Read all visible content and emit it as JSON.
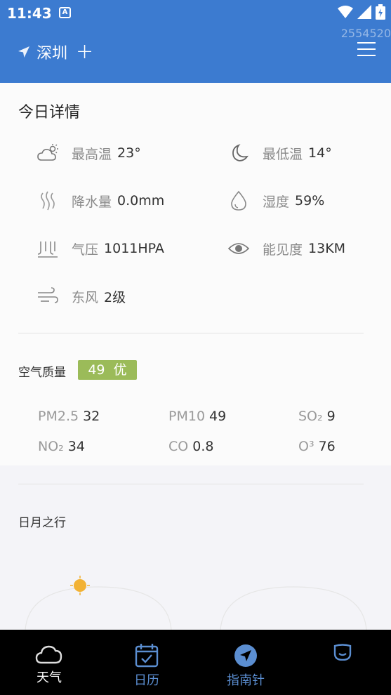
{
  "status": {
    "time": "11:43",
    "notif": "A"
  },
  "watermark": "2554520",
  "header": {
    "city": "深圳"
  },
  "today": {
    "title": "今日详情",
    "items": [
      {
        "label": "最高温",
        "value": "23°",
        "icon": "cloud-sun-icon"
      },
      {
        "label": "最低温",
        "value": "14°",
        "icon": "moon-icon"
      },
      {
        "label": "降水量",
        "value": "0.0mm",
        "icon": "rain-icon"
      },
      {
        "label": "湿度",
        "value": "59%",
        "icon": "humidity-drop-icon"
      },
      {
        "label": "气压",
        "value": "1011HPA",
        "icon": "pressure-icon"
      },
      {
        "label": "能见度",
        "value": "13KM",
        "icon": "eye-icon"
      },
      {
        "label": "东风",
        "value": "2级",
        "icon": "wind-icon"
      }
    ]
  },
  "air": {
    "title": "空气质量",
    "aqi": "49",
    "level": "优",
    "pollutants": [
      {
        "name": "PM2.5",
        "value": "32"
      },
      {
        "name": "PM10",
        "value": "49"
      },
      {
        "name": "SO₂",
        "value": "9"
      },
      {
        "name": "NO₂",
        "value": "34"
      },
      {
        "name": "CO",
        "value": "0.8"
      },
      {
        "name": "O³",
        "value": "76"
      }
    ]
  },
  "sunmoon": {
    "title": "日月之行"
  },
  "nav": [
    {
      "label": "天气",
      "icon": "cloud-icon"
    },
    {
      "label": "日历",
      "icon": "calendar-icon"
    },
    {
      "label": "指南针",
      "icon": "compass-icon"
    },
    {
      "label": "",
      "icon": "face-icon"
    }
  ],
  "colors": {
    "header": "#3c7bd0",
    "aqi_badge": "#9bbb59",
    "sun": "#f2b234",
    "nav_bg": "#000000"
  }
}
